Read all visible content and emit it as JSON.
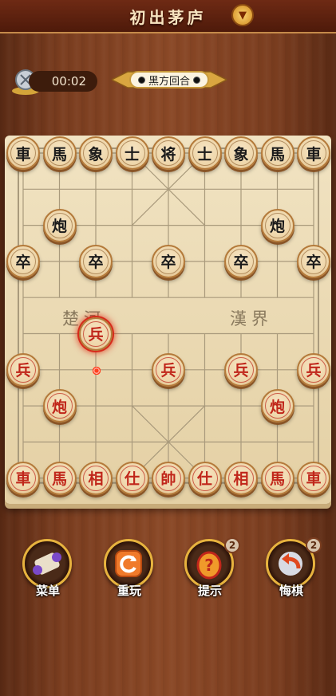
{
  "header": {
    "title": "初出茅庐"
  },
  "status": {
    "timer": "00:02",
    "turn_text": "黑方回合"
  },
  "board": {
    "river_left": "楚河",
    "river_right": "漢界",
    "pieces": [
      {
        "name": "black-chariot-1",
        "text": "車",
        "side": "black",
        "col": 0,
        "row": 0
      },
      {
        "name": "black-horse-1",
        "text": "馬",
        "side": "black",
        "col": 1,
        "row": 0
      },
      {
        "name": "black-elephant-1",
        "text": "象",
        "side": "black",
        "col": 2,
        "row": 0
      },
      {
        "name": "black-advisor-1",
        "text": "士",
        "side": "black",
        "col": 3,
        "row": 0
      },
      {
        "name": "black-general",
        "text": "将",
        "side": "black",
        "col": 4,
        "row": 0
      },
      {
        "name": "black-advisor-2",
        "text": "士",
        "side": "black",
        "col": 5,
        "row": 0
      },
      {
        "name": "black-elephant-2",
        "text": "象",
        "side": "black",
        "col": 6,
        "row": 0
      },
      {
        "name": "black-horse-2",
        "text": "馬",
        "side": "black",
        "col": 7,
        "row": 0
      },
      {
        "name": "black-chariot-2",
        "text": "車",
        "side": "black",
        "col": 8,
        "row": 0
      },
      {
        "name": "black-cannon-1",
        "text": "炮",
        "side": "black",
        "col": 1,
        "row": 2
      },
      {
        "name": "black-cannon-2",
        "text": "炮",
        "side": "black",
        "col": 7,
        "row": 2
      },
      {
        "name": "black-soldier-1",
        "text": "卒",
        "side": "black",
        "col": 0,
        "row": 3
      },
      {
        "name": "black-soldier-2",
        "text": "卒",
        "side": "black",
        "col": 2,
        "row": 3
      },
      {
        "name": "black-soldier-3",
        "text": "卒",
        "side": "black",
        "col": 4,
        "row": 3
      },
      {
        "name": "black-soldier-4",
        "text": "卒",
        "side": "black",
        "col": 6,
        "row": 3
      },
      {
        "name": "black-soldier-5",
        "text": "卒",
        "side": "black",
        "col": 8,
        "row": 3
      },
      {
        "name": "red-soldier-selected",
        "text": "兵",
        "side": "red",
        "col": 2,
        "row": 5,
        "selected": true
      },
      {
        "name": "red-soldier-1",
        "text": "兵",
        "side": "red",
        "col": 0,
        "row": 6
      },
      {
        "name": "red-soldier-3",
        "text": "兵",
        "side": "red",
        "col": 4,
        "row": 6
      },
      {
        "name": "red-soldier-4",
        "text": "兵",
        "side": "red",
        "col": 6,
        "row": 6
      },
      {
        "name": "red-soldier-5",
        "text": "兵",
        "side": "red",
        "col": 8,
        "row": 6
      },
      {
        "name": "red-cannon-1",
        "text": "炮",
        "side": "red",
        "col": 1,
        "row": 7
      },
      {
        "name": "red-cannon-2",
        "text": "炮",
        "side": "red",
        "col": 7,
        "row": 7
      },
      {
        "name": "red-chariot-1",
        "text": "車",
        "side": "red",
        "col": 0,
        "row": 9
      },
      {
        "name": "red-horse-1",
        "text": "馬",
        "side": "red",
        "col": 1,
        "row": 9
      },
      {
        "name": "red-elephant-1",
        "text": "相",
        "side": "red",
        "col": 2,
        "row": 9
      },
      {
        "name": "red-advisor-1",
        "text": "仕",
        "side": "red",
        "col": 3,
        "row": 9
      },
      {
        "name": "red-general",
        "text": "帥",
        "side": "red",
        "col": 4,
        "row": 9
      },
      {
        "name": "red-advisor-2",
        "text": "仕",
        "side": "red",
        "col": 5,
        "row": 9
      },
      {
        "name": "red-elephant-2",
        "text": "相",
        "side": "red",
        "col": 6,
        "row": 9
      },
      {
        "name": "red-horse-2",
        "text": "馬",
        "side": "red",
        "col": 7,
        "row": 9
      },
      {
        "name": "red-chariot-2",
        "text": "車",
        "side": "red",
        "col": 8,
        "row": 9
      }
    ]
  },
  "actions": {
    "menu": {
      "label": "菜单"
    },
    "restart": {
      "label": "重玩"
    },
    "hint": {
      "label": "提示",
      "count": "2"
    },
    "undo": {
      "label": "悔棋",
      "count": "2"
    }
  },
  "colors": {
    "red_piece": "#c0261a",
    "black_piece": "#1a1a1a",
    "board": "#efdfbc",
    "accent_gold": "#e7b33e"
  }
}
